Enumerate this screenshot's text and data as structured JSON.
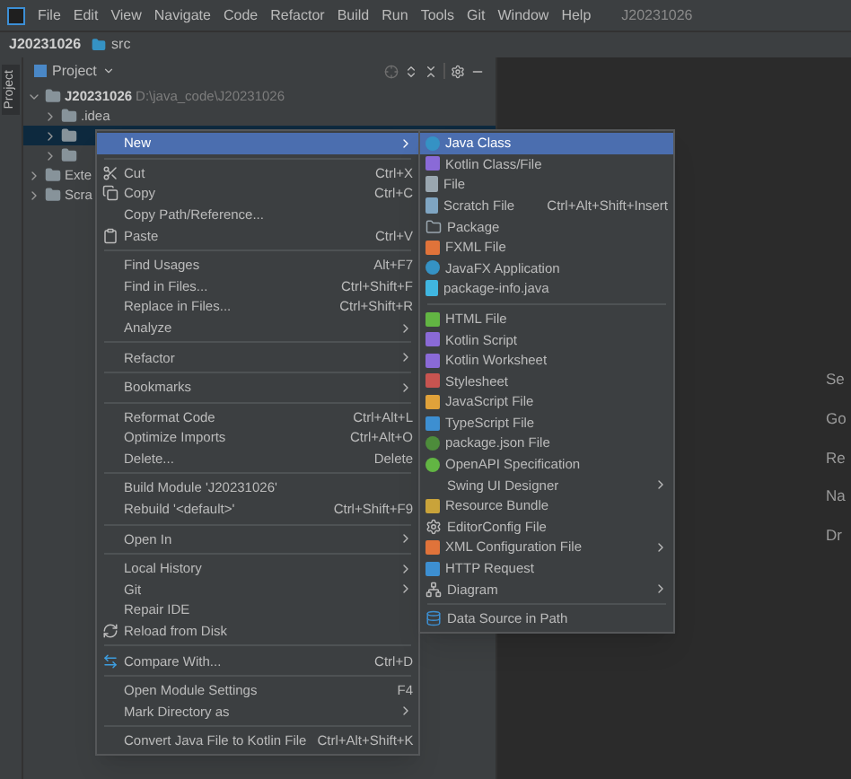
{
  "menu_bar": {
    "items": [
      "File",
      "Edit",
      "View",
      "Navigate",
      "Code",
      "Refactor",
      "Build",
      "Run",
      "Tools",
      "Git",
      "Window",
      "Help"
    ],
    "project_title": "J20231026"
  },
  "breadcrumb": [
    "J20231026",
    "src"
  ],
  "tool_strip": {
    "label": "Project"
  },
  "project_panel": {
    "title": "Project",
    "tree": [
      {
        "label": "J20231026",
        "path": "D:\\java_code\\J20231026",
        "expanded": true,
        "selected": false,
        "children": [
          {
            "label": ".idea",
            "expanded": false,
            "selected": false
          },
          {
            "expanded": false,
            "selected": true
          },
          {
            "expanded": false,
            "selected": false
          }
        ]
      },
      {
        "label": "Exte",
        "expanded": false,
        "selected": false
      },
      {
        "label": "Scra",
        "expanded": false,
        "selected": false
      }
    ]
  },
  "context_menu": [
    {
      "label": "New",
      "submenu": true,
      "selected": true
    },
    {
      "kind": "separator"
    },
    {
      "label": "Cut",
      "shortcut": "Ctrl+X",
      "selected": false
    },
    {
      "label": "Copy",
      "shortcut": "Ctrl+C",
      "selected": false
    },
    {
      "label": "Copy Path/Reference...",
      "selected": false
    },
    {
      "label": "Paste",
      "shortcut": "Ctrl+V",
      "selected": false
    },
    {
      "kind": "separator"
    },
    {
      "label": "Find Usages",
      "shortcut": "Alt+F7",
      "selected": false
    },
    {
      "label": "Find in Files...",
      "shortcut": "Ctrl+Shift+F",
      "selected": false
    },
    {
      "label": "Replace in Files...",
      "shortcut": "Ctrl+Shift+R",
      "selected": false
    },
    {
      "label": "Analyze",
      "submenu": true,
      "selected": false
    },
    {
      "kind": "separator"
    },
    {
      "label": "Refactor",
      "submenu": true,
      "selected": false
    },
    {
      "kind": "separator"
    },
    {
      "label": "Bookmarks",
      "submenu": true,
      "selected": false
    },
    {
      "kind": "separator"
    },
    {
      "label": "Reformat Code",
      "shortcut": "Ctrl+Alt+L",
      "selected": false
    },
    {
      "label": "Optimize Imports",
      "shortcut": "Ctrl+Alt+O",
      "selected": false
    },
    {
      "label": "Delete...",
      "shortcut": "Delete",
      "selected": false
    },
    {
      "kind": "separator"
    },
    {
      "label": "Build Module 'J20231026'",
      "selected": false
    },
    {
      "label": "Rebuild '<default>'",
      "shortcut": "Ctrl+Shift+F9",
      "selected": false
    },
    {
      "kind": "separator"
    },
    {
      "label": "Open In",
      "submenu": true,
      "selected": false
    },
    {
      "kind": "separator"
    },
    {
      "label": "Local History",
      "submenu": true,
      "selected": false
    },
    {
      "label": "Git",
      "submenu": true,
      "selected": false
    },
    {
      "label": "Repair IDE",
      "selected": false
    },
    {
      "label": "Reload from Disk",
      "selected": false
    },
    {
      "kind": "separator"
    },
    {
      "label": "Compare With...",
      "shortcut": "Ctrl+D",
      "selected": false
    },
    {
      "kind": "separator"
    },
    {
      "label": "Open Module Settings",
      "shortcut": "F4",
      "selected": false
    },
    {
      "label": "Mark Directory as",
      "submenu": true,
      "selected": false
    },
    {
      "kind": "separator"
    },
    {
      "label": "Convert Java File to Kotlin File",
      "shortcut": "Ctrl+Alt+Shift+K",
      "selected": false
    }
  ],
  "new_submenu": [
    {
      "label": "Java Class",
      "selected": true
    },
    {
      "label": "Kotlin Class/File",
      "selected": false
    },
    {
      "label": "File",
      "selected": false
    },
    {
      "label": "Scratch File",
      "shortcut": "Ctrl+Alt+Shift+Insert",
      "selected": false
    },
    {
      "label": "Package",
      "selected": false
    },
    {
      "label": "FXML File",
      "selected": false
    },
    {
      "label": "JavaFX Application",
      "selected": false
    },
    {
      "label": "package-info.java",
      "selected": false
    },
    {
      "kind": "separator"
    },
    {
      "label": "HTML File",
      "selected": false
    },
    {
      "label": "Kotlin Script",
      "selected": false
    },
    {
      "label": "Kotlin Worksheet",
      "selected": false
    },
    {
      "label": "Stylesheet",
      "selected": false
    },
    {
      "label": "JavaScript File",
      "selected": false
    },
    {
      "label": "TypeScript File",
      "selected": false
    },
    {
      "label": "package.json File",
      "selected": false
    },
    {
      "label": "OpenAPI Specification",
      "selected": false
    },
    {
      "label": "Swing UI Designer",
      "submenu": true,
      "selected": false
    },
    {
      "label": "Resource Bundle",
      "selected": false
    },
    {
      "label": "EditorConfig File",
      "selected": false
    },
    {
      "label": "XML Configuration File",
      "submenu": true,
      "selected": false
    },
    {
      "label": "HTTP Request",
      "selected": false
    },
    {
      "label": "Diagram",
      "submenu": true,
      "selected": false
    },
    {
      "kind": "separator"
    },
    {
      "label": "Data Source in Path",
      "selected": false
    }
  ],
  "editor_hints": [
    "Se",
    "Go",
    "Re",
    "Na",
    "Dr"
  ]
}
